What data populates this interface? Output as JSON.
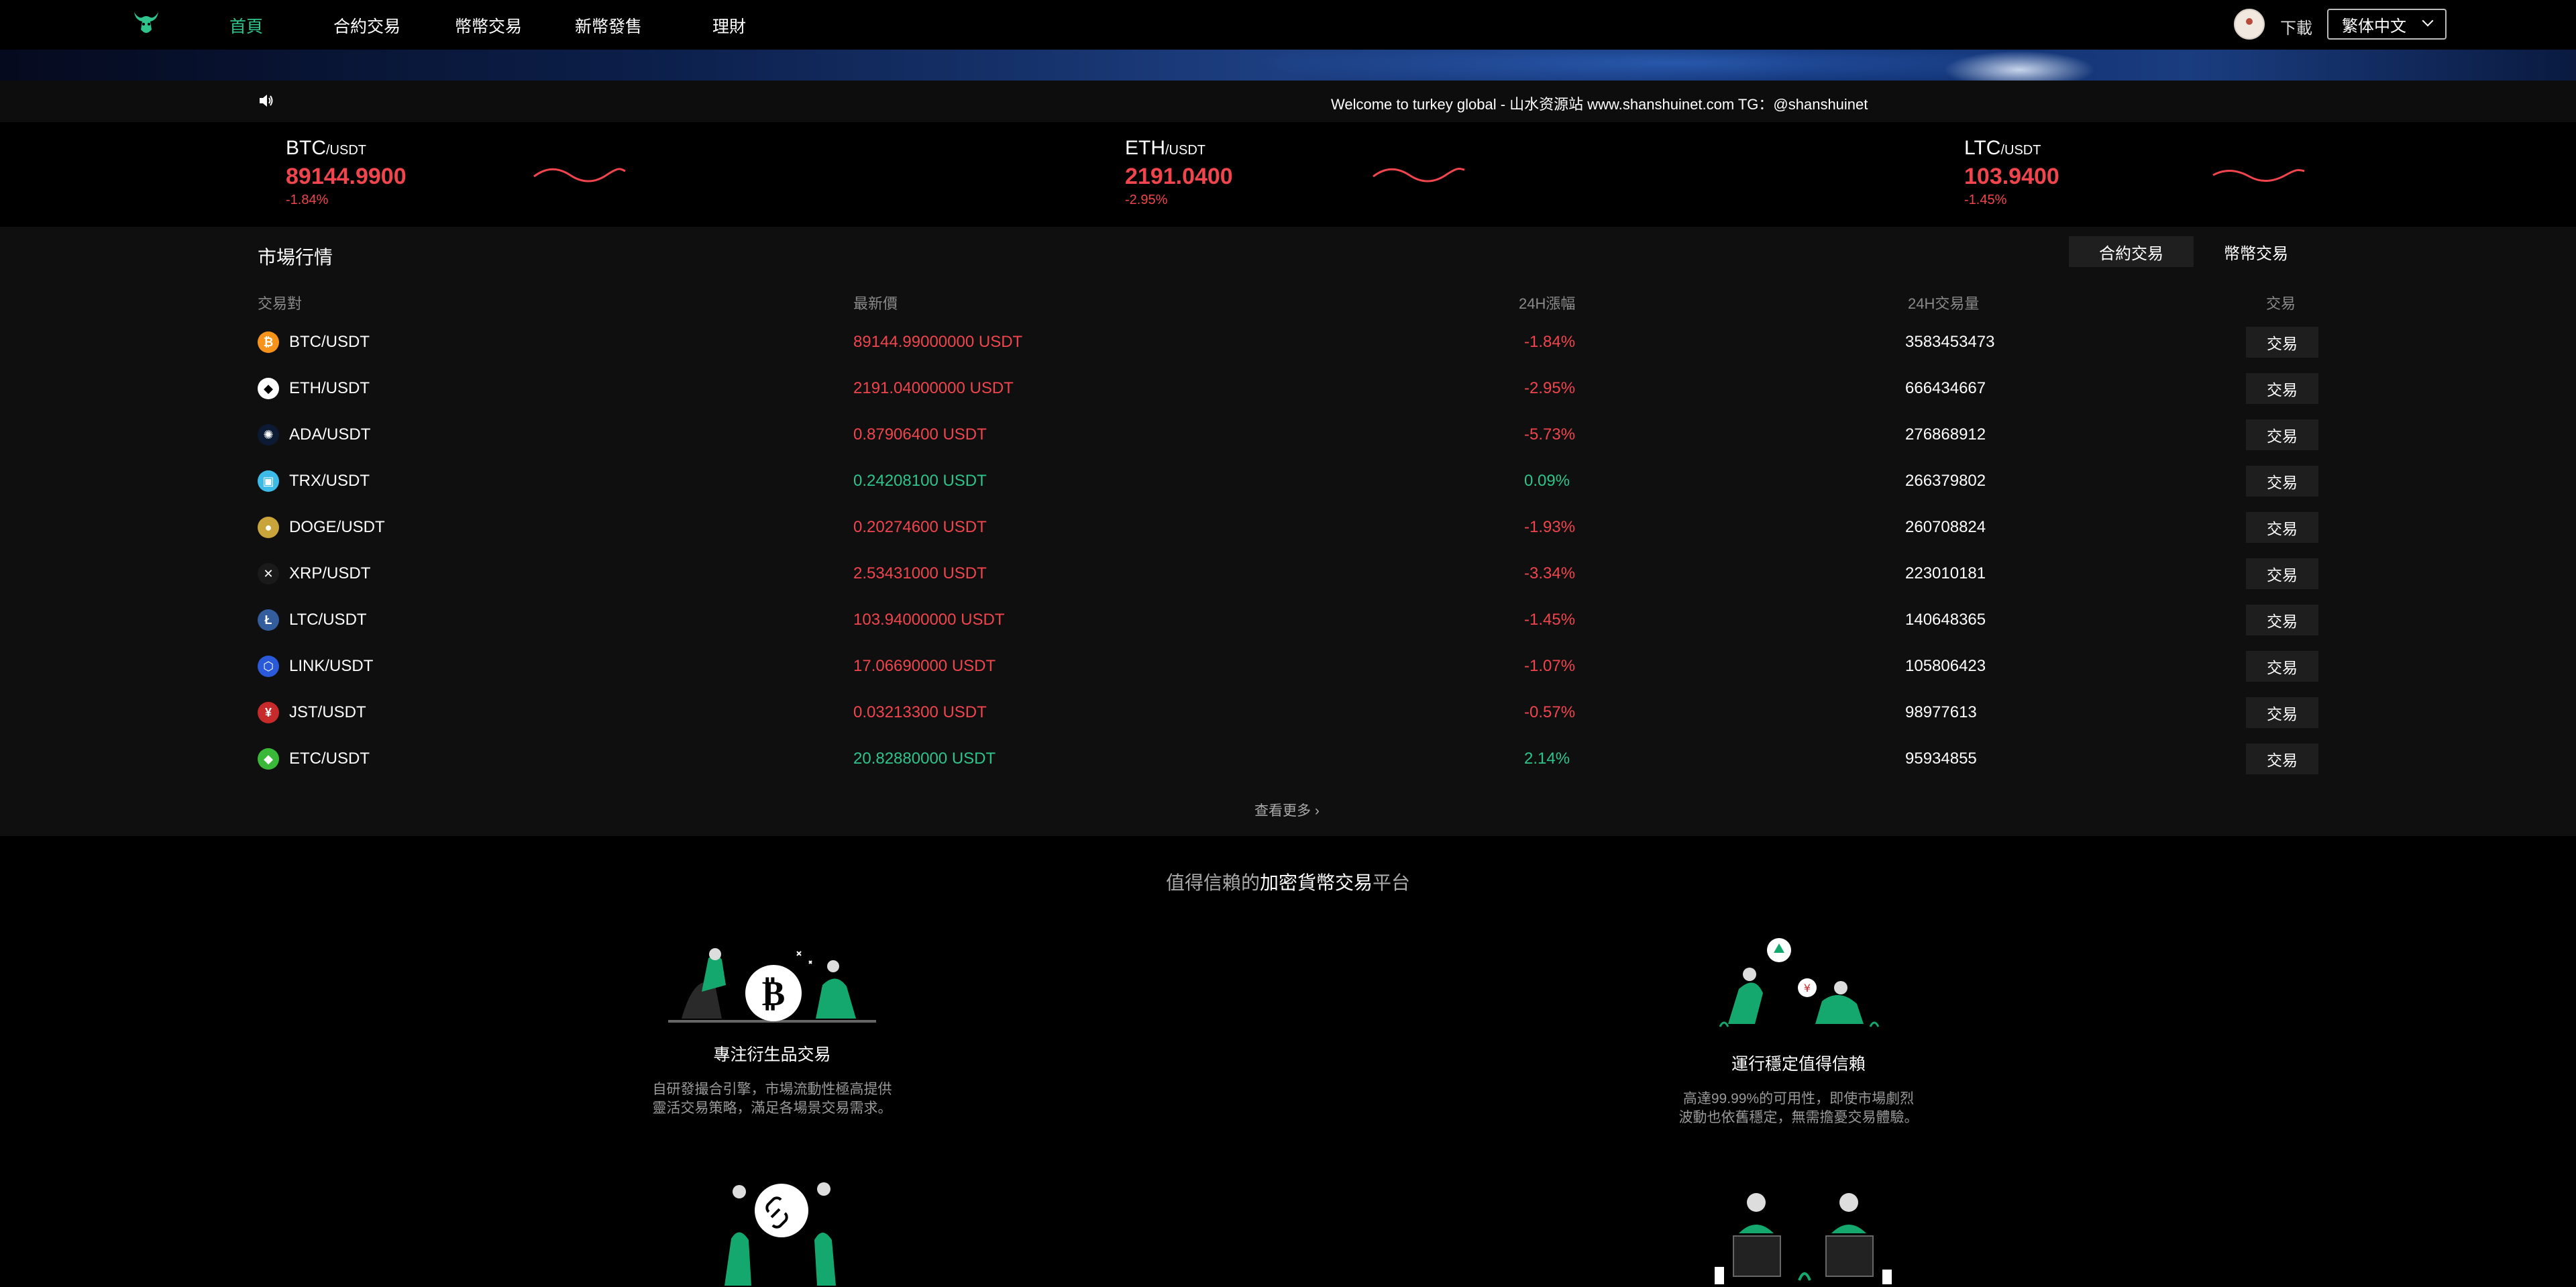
{
  "nav": {
    "items": [
      {
        "label": "首頁",
        "active": true
      },
      {
        "label": "合約交易",
        "active": false
      },
      {
        "label": "幣幣交易",
        "active": false
      },
      {
        "label": "新幣發售",
        "active": false
      },
      {
        "label": "理財",
        "active": false
      }
    ],
    "download_label": "下載",
    "language": "繁体中文",
    "logo_icon": "bull-logo-icon",
    "brand_color": "#2ec48c"
  },
  "notice": {
    "icon": "speaker-icon",
    "text": "Welcome to turkey global - 山水资源站 www.shanshuinet.com TG：@shanshuinet"
  },
  "tickers": [
    {
      "base": "BTC",
      "quote": "/USDT",
      "price": "89144.9900",
      "change": "-1.84%"
    },
    {
      "base": "ETH",
      "quote": "/USDT",
      "price": "2191.0400",
      "change": "-2.95%"
    },
    {
      "base": "LTC",
      "quote": "/USDT",
      "price": "103.9400",
      "change": "-1.45%"
    }
  ],
  "market": {
    "title": "市場行情",
    "tabs": [
      "合約交易",
      "幣幣交易"
    ],
    "headers": {
      "pair": "交易對",
      "price": "最新價",
      "change": "24H漲幅",
      "volume": "24H交易量",
      "action": "交易"
    },
    "trade_label": "交易",
    "more_label": "查看更多",
    "rows": [
      {
        "pair": "BTC/USDT",
        "price": "89144.99000000 USDT",
        "change": "-1.84%",
        "volume": "3583453473",
        "up": false,
        "icon": "btc-icon",
        "color": "#f7931a",
        "glyph": "₿"
      },
      {
        "pair": "ETH/USDT",
        "price": "2191.04000000 USDT",
        "change": "-2.95%",
        "volume": "666434667",
        "up": false,
        "icon": "eth-icon",
        "color": "#ffffff",
        "glyph": "◆"
      },
      {
        "pair": "ADA/USDT",
        "price": "0.87906400 USDT",
        "change": "-5.73%",
        "volume": "276868912",
        "up": false,
        "icon": "ada-icon",
        "color": "#0d1a33",
        "glyph": "✺"
      },
      {
        "pair": "TRX/USDT",
        "price": "0.24208100 USDT",
        "change": "0.09%",
        "volume": "266379802",
        "up": true,
        "icon": "trx-icon",
        "color": "#3dbbe8",
        "glyph": "▣"
      },
      {
        "pair": "DOGE/USDT",
        "price": "0.20274600 USDT",
        "change": "-1.93%",
        "volume": "260708824",
        "up": false,
        "icon": "doge-icon",
        "color": "#c9a43a",
        "glyph": "●"
      },
      {
        "pair": "XRP/USDT",
        "price": "2.53431000 USDT",
        "change": "-3.34%",
        "volume": "223010181",
        "up": false,
        "icon": "xrp-icon",
        "color": "#1a1a1a",
        "glyph": "✕"
      },
      {
        "pair": "LTC/USDT",
        "price": "103.94000000 USDT",
        "change": "-1.45%",
        "volume": "140648365",
        "up": false,
        "icon": "ltc-icon",
        "color": "#345d9d",
        "glyph": "Ł"
      },
      {
        "pair": "LINK/USDT",
        "price": "17.06690000 USDT",
        "change": "-1.07%",
        "volume": "105806423",
        "up": false,
        "icon": "link-icon",
        "color": "#2a5ada",
        "glyph": "⬡"
      },
      {
        "pair": "JST/USDT",
        "price": "0.03213300 USDT",
        "change": "-0.57%",
        "volume": "98977613",
        "up": false,
        "icon": "jst-icon",
        "color": "#c62a2a",
        "glyph": "¥"
      },
      {
        "pair": "ETC/USDT",
        "price": "20.82880000 USDT",
        "change": "2.14%",
        "volume": "95934855",
        "up": true,
        "icon": "etc-icon",
        "color": "#3ab83a",
        "glyph": "◆"
      }
    ],
    "colors": {
      "down": "#f0454d",
      "up": "#2ec48c"
    }
  },
  "trust": {
    "title_pre": "值得信賴的",
    "title_bold": "加密貨幣交易",
    "title_post": "平台",
    "features": [
      {
        "title": "專注衍生品交易",
        "desc1": "自研發撮合引擎，市場流動性極高提供",
        "desc2": "靈活交易策略，滿足各場景交易需求。"
      },
      {
        "title": "運行穩定值得信賴",
        "desc1": "高達99.99%的可用性，即使市場劇烈",
        "desc2": "波動也依舊穩定，無需擔憂交易體驗。"
      }
    ]
  }
}
